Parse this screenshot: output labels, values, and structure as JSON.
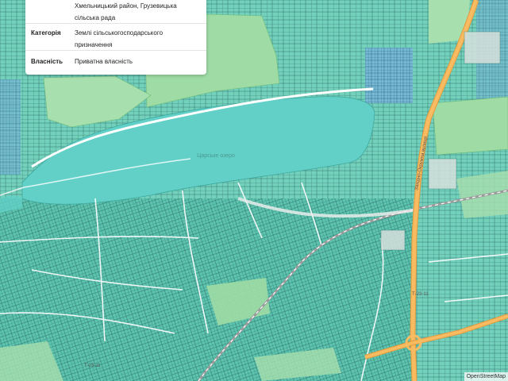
{
  "popup": {
    "rows": [
      {
        "key": "",
        "value": "Хмельницький район, Грузевицька сільська рада"
      },
      {
        "key": "Категорія",
        "value": "Землі сільськогосподарського призначення"
      },
      {
        "key": "Власність",
        "value": "Приватна власність"
      }
    ]
  },
  "map": {
    "lake_label": "Царське озеро",
    "roads": [
      {
        "label": "Західно-Окружна вулиця"
      },
      {
        "label": "Т-23-11"
      },
      {
        "label": "Т-23-11"
      }
    ],
    "attribution": "OpenStreetMap",
    "colors": {
      "base": "#eae6df",
      "parcel_fill": "#6ccfb9",
      "parcel_stroke": "#2a6e69",
      "lake": "#62d0c7",
      "meadow": "#9fdba5",
      "highway": "#f7bb62",
      "railway": "#9a9a9a"
    }
  }
}
